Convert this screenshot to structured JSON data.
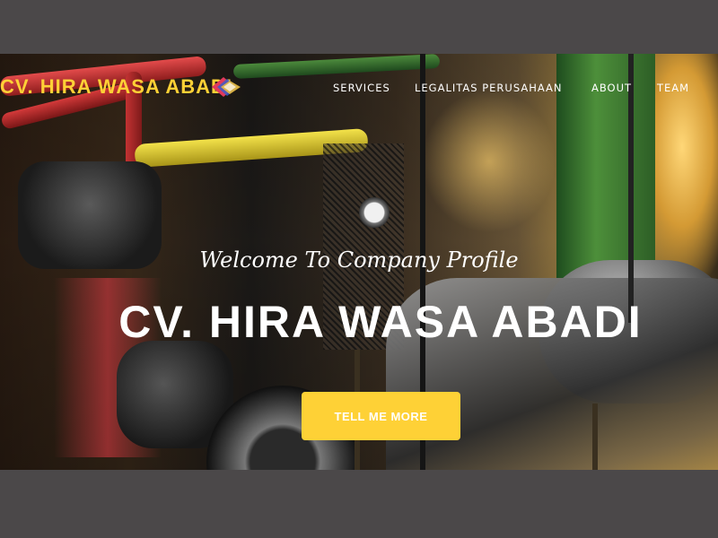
{
  "navbar": {
    "brand": "CV. HIRA WASA ABADI",
    "logo_icon": "diamond-logo-icon",
    "links": [
      {
        "label": "SERVICES"
      },
      {
        "label": "LEGALITAS PERUSAHAAN"
      },
      {
        "label": "ABOUT"
      },
      {
        "label": "TEAM"
      }
    ]
  },
  "hero": {
    "lead": "Welcome To Company Profile",
    "heading": "CV. HIRA WASA ABADI",
    "button_label": "TELL ME MORE"
  },
  "colors": {
    "accent": "#fed136",
    "page_background": "#4b4849",
    "text_light": "#ffffff"
  }
}
